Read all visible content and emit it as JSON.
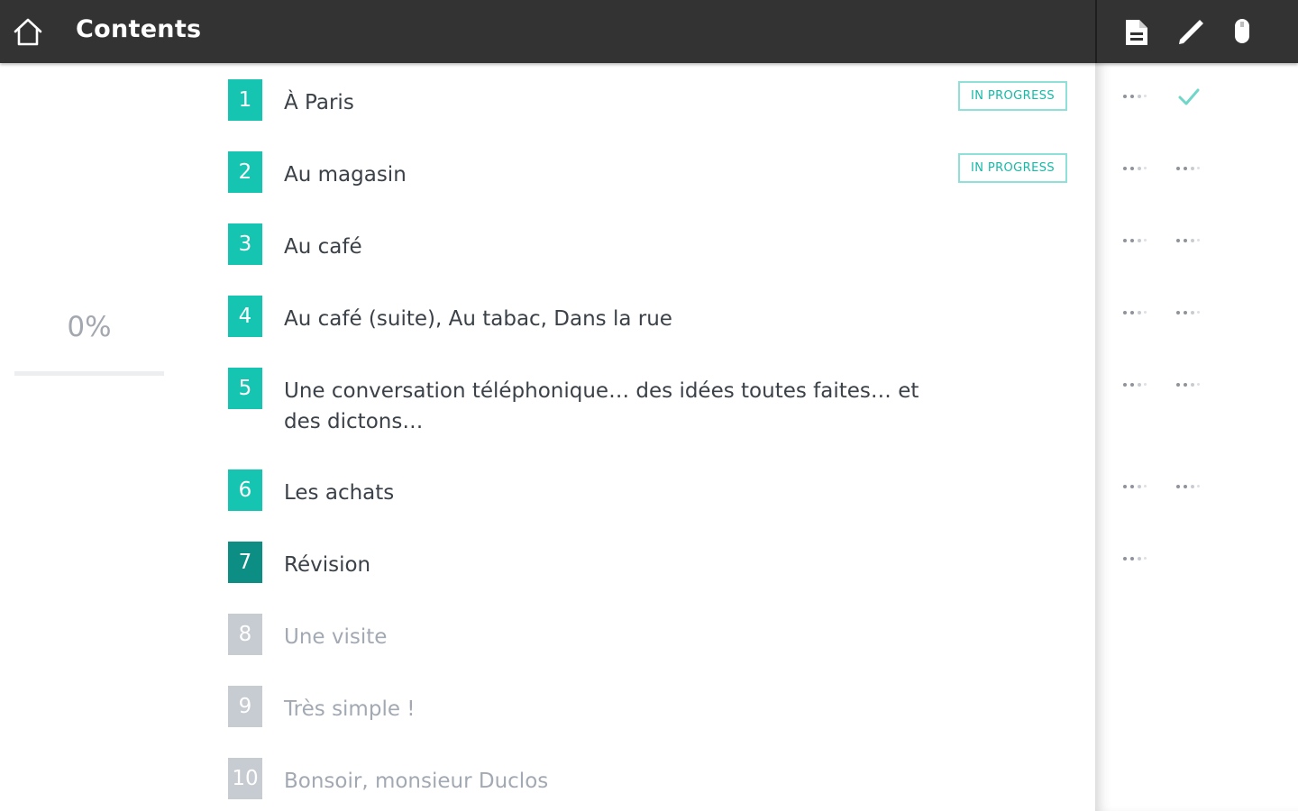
{
  "header": {
    "title": "Contents"
  },
  "progress": {
    "label": "0%",
    "value": 0
  },
  "lessons": [
    {
      "number": "1",
      "title": "À Paris",
      "badge": "IN PROGRESS",
      "state": "done"
    },
    {
      "number": "2",
      "title": "Au magasin",
      "badge": "IN PROGRESS",
      "state": "done"
    },
    {
      "number": "3",
      "title": "Au café",
      "state": "done"
    },
    {
      "number": "4",
      "title": "Au café (suite), Au tabac, Dans la rue",
      "state": "done"
    },
    {
      "number": "5",
      "title": "Une conversation téléphonique… des idées toutes faites… et des dictons…",
      "state": "done"
    },
    {
      "number": "6",
      "title": "Les achats",
      "state": "done"
    },
    {
      "number": "7",
      "title": "Révision",
      "state": "current"
    },
    {
      "number": "8",
      "title": "Une visite",
      "state": "locked"
    },
    {
      "number": "9",
      "title": "Très simple !",
      "state": "locked"
    },
    {
      "number": "10",
      "title": "Bonsoir, monsieur Duclos",
      "state": "locked"
    }
  ],
  "colors": {
    "accent": "#16c4b2",
    "accent_dark": "#0d8e84",
    "locked": "#c7cbd2",
    "topbar": "#333333"
  }
}
